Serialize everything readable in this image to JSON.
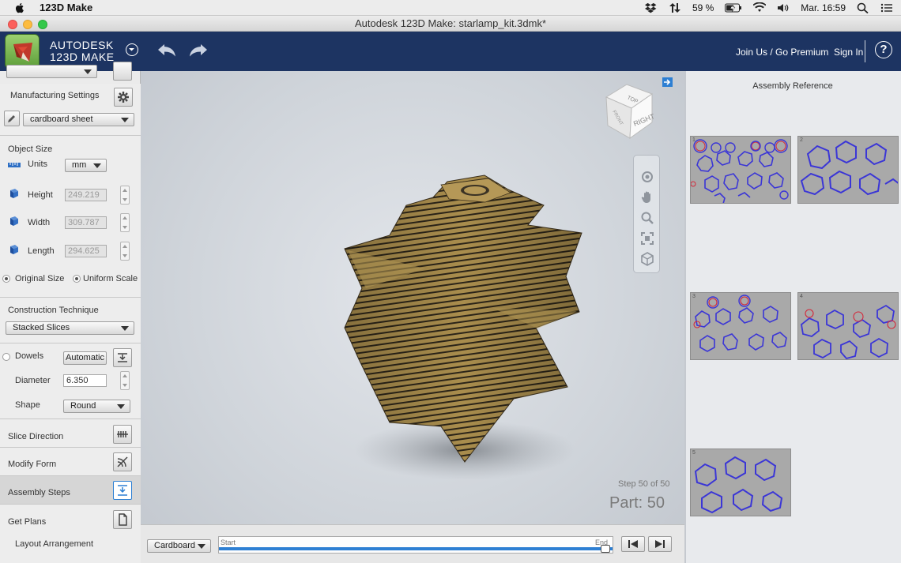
{
  "menubar": {
    "app_name": "123D Make",
    "battery": "59 %",
    "clock": "Mar. 16:59"
  },
  "window": {
    "title": "Autodesk 123D Make: starlamp_kit.3dmk*"
  },
  "header": {
    "brand_line1": "AUTODESK",
    "brand_line2": "123D MAKE",
    "join_link": "Join Us / Go Premium",
    "signin_link": "Sign In",
    "help_label": "?"
  },
  "left_panel": {
    "manufacturing": {
      "label": "Manufacturing Settings",
      "material": "cardboard sheet"
    },
    "object_size": {
      "label": "Object Size",
      "units_label": "Units",
      "units_value": "mm",
      "height_label": "Height",
      "height_value": "249.219",
      "width_label": "Width",
      "width_value": "309.787",
      "length_label": "Length",
      "length_value": "294.625",
      "original_size_label": "Original Size",
      "uniform_scale_label": "Uniform Scale"
    },
    "construction": {
      "label": "Construction Technique",
      "value": "Stacked Slices"
    },
    "dowels": {
      "label": "Dowels",
      "mode": "Automatic",
      "diameter_label": "Diameter",
      "diameter_value": "6.350",
      "shape_label": "Shape",
      "shape_value": "Round"
    },
    "slice_direction": "Slice Direction",
    "modify_form": "Modify Form",
    "assembly_steps": "Assembly Steps",
    "get_plans": "Get Plans",
    "layout_arrangement": "Layout Arrangement"
  },
  "viewport": {
    "viewcube_top": "TOP",
    "viewcube_front": "FRONT",
    "viewcube_right": "RIGHT",
    "step_text": "Step 50 of 50",
    "part_text": "Part: 50"
  },
  "bottom_bar": {
    "material_select": "Cardboard",
    "slider_start": "Start",
    "slider_end": "End"
  },
  "right_panel": {
    "title": "Assembly Reference",
    "thumbnails": [
      {
        "num": "1"
      },
      {
        "num": "2"
      },
      {
        "num": "3"
      },
      {
        "num": "4"
      },
      {
        "num": "5"
      }
    ]
  },
  "colors": {
    "header_bg": "#1d3462",
    "accent_blue": "#2d7fd3",
    "cardboard": "#a98d4d",
    "outline_blue": "#3b36d6",
    "outline_red": "#d4283a"
  }
}
